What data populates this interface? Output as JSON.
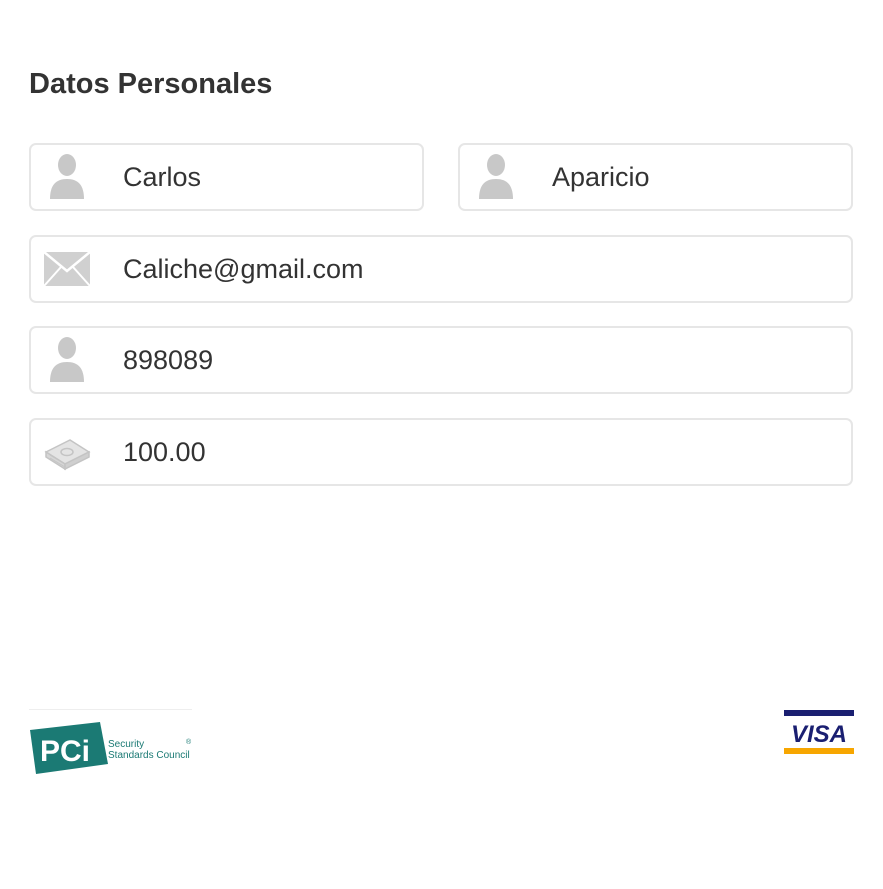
{
  "section": {
    "title": "Datos Personales"
  },
  "fields": {
    "first_name": {
      "value": "Carlos",
      "icon": "user-icon"
    },
    "last_name": {
      "value": "Aparicio",
      "icon": "user-icon"
    },
    "email": {
      "value": "Caliche@gmail.com",
      "icon": "envelope-icon"
    },
    "id_number": {
      "value": "898089",
      "icon": "user-icon"
    },
    "amount": {
      "value": "100.00",
      "icon": "money-icon"
    }
  },
  "footer": {
    "pci_logo": {
      "mark": "PCi",
      "line1": "Security",
      "line2": "Standards Council"
    },
    "visa_logo": {
      "text": "VISA"
    }
  },
  "colors": {
    "icon_gray": "#c8c8c8",
    "border": "#e6e6e6",
    "pci_teal": "#1b7a74",
    "visa_blue": "#1a1f71",
    "visa_gold": "#f7a600"
  }
}
